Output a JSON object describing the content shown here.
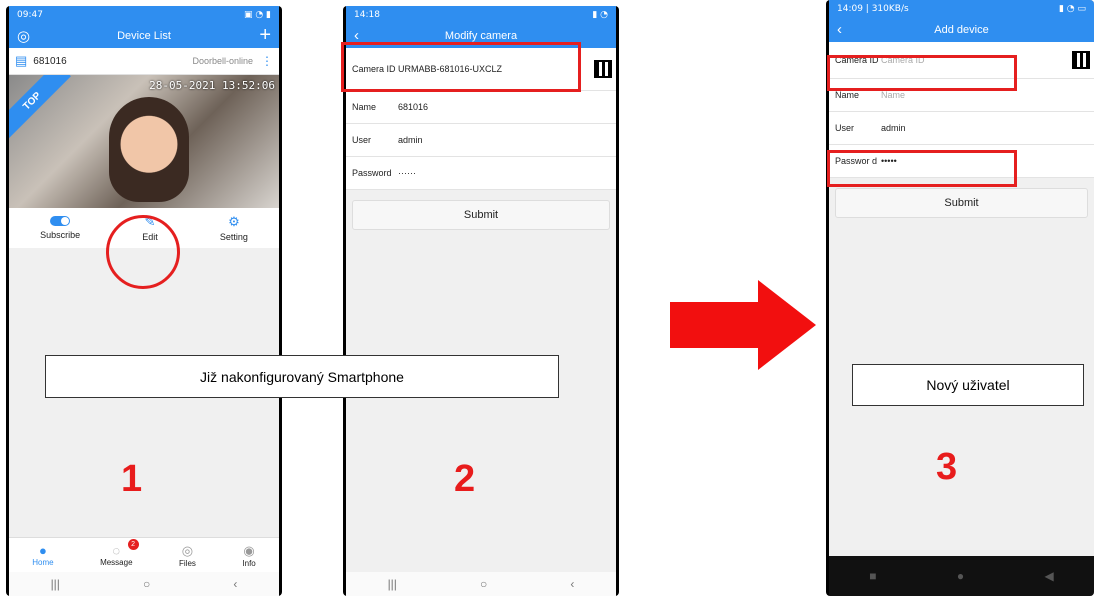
{
  "phone1": {
    "status_time": "09:47",
    "title": "Device List",
    "device_name": "681016",
    "device_status": "Doorbell-online",
    "badge_top": "TOP",
    "timestamp": "28-05-2021 13:52:06",
    "actions": [
      {
        "label": "Subscribe"
      },
      {
        "label": "Edit"
      },
      {
        "label": "Setting"
      }
    ],
    "tabs": [
      {
        "label": "Home"
      },
      {
        "label": "Message",
        "badge": "2"
      },
      {
        "label": "Files"
      },
      {
        "label": "Info"
      }
    ],
    "big_number": "1"
  },
  "phone2": {
    "status_time": "14:18",
    "title": "Modify camera",
    "fields": {
      "camera_id_label": "Camera ID",
      "camera_id_value": "URMABB-681016-UXCLZ",
      "name_label": "Name",
      "name_value": "681016",
      "user_label": "User",
      "user_value": "admin",
      "password_label": "Password",
      "password_value": "······"
    },
    "submit": "Submit",
    "big_number": "2"
  },
  "phone3": {
    "status_time": "14:09 | 310KB/s",
    "title": "Add device",
    "fields": {
      "camera_id_label": "Camera ID",
      "camera_id_placeholder": "Camera ID",
      "name_label": "Name",
      "name_placeholder": "Name",
      "user_label": "User",
      "user_value": "admin",
      "password_label": "Passwor d",
      "password_value": "•••••"
    },
    "submit": "Submit",
    "big_number": "3"
  },
  "callouts": {
    "configured": "Již nakonfigurovaný Smartphone",
    "new_user": "Nový uživatel"
  },
  "colors": {
    "accent": "#2f8ef0",
    "highlight_red": "#e51f1f"
  }
}
